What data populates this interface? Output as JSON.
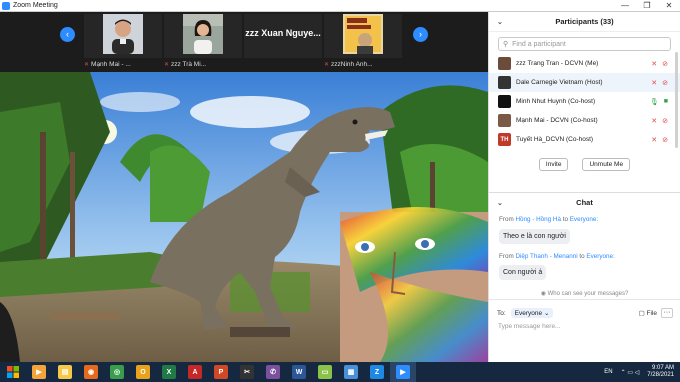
{
  "window": {
    "title": "Zoom Meeting",
    "controls": [
      "—",
      "❐",
      "✕"
    ]
  },
  "thumbnails": [
    {
      "name": "Mạnh Mai - ...",
      "muted": true,
      "type": "video"
    },
    {
      "name": "zzz Trà Mi...",
      "muted": true,
      "type": "video"
    },
    {
      "name": "zzz Xuan Nguye...",
      "muted": false,
      "type": "text"
    },
    {
      "name": "zzzNinh Anh...",
      "muted": true,
      "type": "video"
    }
  ],
  "nav": {
    "prev": "‹",
    "next": "›"
  },
  "participants": {
    "header": "Participants (33)",
    "search_placeholder": "Find a participant",
    "list": [
      {
        "name": "zzz Trang Tran - DCVN (Me)",
        "avatar_color": "#6b4b3a",
        "avatar_text": "",
        "highlight": false,
        "video_on": false,
        "mic_on": false
      },
      {
        "name": "Dale Carnegie Vietnam (Host)",
        "avatar_color": "#333333",
        "avatar_text": "",
        "highlight": true,
        "video_on": false,
        "mic_on": false
      },
      {
        "name": "Minh Nhut Huynh (Co-host)",
        "avatar_color": "#111111",
        "avatar_text": "",
        "highlight": false,
        "video_on": true,
        "mic_on": true
      },
      {
        "name": "Mạnh Mai - DCVN (Co-host)",
        "avatar_color": "#7a5a44",
        "avatar_text": "",
        "highlight": false,
        "video_on": false,
        "mic_on": false
      },
      {
        "name": "Tuyết Hà_DCVN (Co-host)",
        "avatar_color": "#c0392b",
        "avatar_text": "TH",
        "highlight": false,
        "video_on": false,
        "mic_on": false
      }
    ],
    "invite_label": "Invite",
    "unmute_label": "Unmute Me"
  },
  "chat": {
    "header": "Chat",
    "messages": [
      {
        "from_label": "From",
        "sender": "Hồng - Hồng Hà",
        "to_label": "to",
        "recipient": "Everyone:",
        "text": "Theo e là con người"
      },
      {
        "from_label": "From",
        "sender": "Diệp Thanh - Menanni",
        "to_label": "to",
        "recipient": "Everyone:",
        "text": "Con người á"
      }
    ],
    "who_can_see": "Who can see your messages?",
    "to_label": "To:",
    "to_value": "Everyone",
    "file_label": "File",
    "more_label": "···",
    "input_placeholder": "Type message here..."
  },
  "taskbar": {
    "language": "EN",
    "time": "9:07 AM",
    "date": "7/28/2021",
    "apps": [
      {
        "name": "media-player",
        "color": "#f2a33a",
        "glyph": "▶"
      },
      {
        "name": "file-explorer",
        "color": "#f5c84a",
        "glyph": "▤"
      },
      {
        "name": "firefox",
        "color": "#e66a1c",
        "glyph": "◉"
      },
      {
        "name": "chrome",
        "color": "#3a9d4c",
        "glyph": "◎"
      },
      {
        "name": "outlook",
        "color": "#e8a21b",
        "glyph": "O"
      },
      {
        "name": "excel",
        "color": "#1f7a45",
        "glyph": "X"
      },
      {
        "name": "acrobat",
        "color": "#c62828",
        "glyph": "A"
      },
      {
        "name": "powerpoint",
        "color": "#d24726",
        "glyph": "P"
      },
      {
        "name": "capcut",
        "color": "#333333",
        "glyph": "✂"
      },
      {
        "name": "viber",
        "color": "#7b519d",
        "glyph": "✆"
      },
      {
        "name": "word",
        "color": "#2b5797",
        "glyph": "W"
      },
      {
        "name": "folder-green",
        "color": "#8bc34a",
        "glyph": "▭"
      },
      {
        "name": "store",
        "color": "#4a90d9",
        "glyph": "▦"
      },
      {
        "name": "zalo",
        "color": "#1e88e5",
        "glyph": "Z"
      },
      {
        "name": "zoom",
        "color": "#2d8cff",
        "glyph": "▶"
      }
    ]
  }
}
